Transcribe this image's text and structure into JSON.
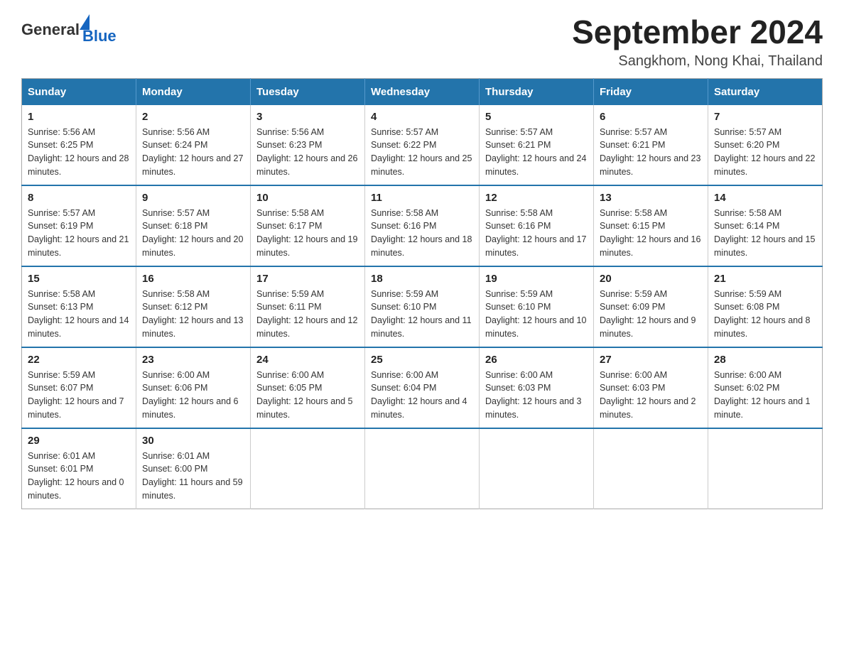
{
  "logo": {
    "text_general": "General",
    "text_blue": "Blue"
  },
  "header": {
    "title": "September 2024",
    "location": "Sangkhom, Nong Khai, Thailand"
  },
  "weekdays": [
    "Sunday",
    "Monday",
    "Tuesday",
    "Wednesday",
    "Thursday",
    "Friday",
    "Saturday"
  ],
  "weeks": [
    [
      {
        "day": "1",
        "sunrise": "5:56 AM",
        "sunset": "6:25 PM",
        "daylight": "12 hours and 28 minutes."
      },
      {
        "day": "2",
        "sunrise": "5:56 AM",
        "sunset": "6:24 PM",
        "daylight": "12 hours and 27 minutes."
      },
      {
        "day": "3",
        "sunrise": "5:56 AM",
        "sunset": "6:23 PM",
        "daylight": "12 hours and 26 minutes."
      },
      {
        "day": "4",
        "sunrise": "5:57 AM",
        "sunset": "6:22 PM",
        "daylight": "12 hours and 25 minutes."
      },
      {
        "day": "5",
        "sunrise": "5:57 AM",
        "sunset": "6:21 PM",
        "daylight": "12 hours and 24 minutes."
      },
      {
        "day": "6",
        "sunrise": "5:57 AM",
        "sunset": "6:21 PM",
        "daylight": "12 hours and 23 minutes."
      },
      {
        "day": "7",
        "sunrise": "5:57 AM",
        "sunset": "6:20 PM",
        "daylight": "12 hours and 22 minutes."
      }
    ],
    [
      {
        "day": "8",
        "sunrise": "5:57 AM",
        "sunset": "6:19 PM",
        "daylight": "12 hours and 21 minutes."
      },
      {
        "day": "9",
        "sunrise": "5:57 AM",
        "sunset": "6:18 PM",
        "daylight": "12 hours and 20 minutes."
      },
      {
        "day": "10",
        "sunrise": "5:58 AM",
        "sunset": "6:17 PM",
        "daylight": "12 hours and 19 minutes."
      },
      {
        "day": "11",
        "sunrise": "5:58 AM",
        "sunset": "6:16 PM",
        "daylight": "12 hours and 18 minutes."
      },
      {
        "day": "12",
        "sunrise": "5:58 AM",
        "sunset": "6:16 PM",
        "daylight": "12 hours and 17 minutes."
      },
      {
        "day": "13",
        "sunrise": "5:58 AM",
        "sunset": "6:15 PM",
        "daylight": "12 hours and 16 minutes."
      },
      {
        "day": "14",
        "sunrise": "5:58 AM",
        "sunset": "6:14 PM",
        "daylight": "12 hours and 15 minutes."
      }
    ],
    [
      {
        "day": "15",
        "sunrise": "5:58 AM",
        "sunset": "6:13 PM",
        "daylight": "12 hours and 14 minutes."
      },
      {
        "day": "16",
        "sunrise": "5:58 AM",
        "sunset": "6:12 PM",
        "daylight": "12 hours and 13 minutes."
      },
      {
        "day": "17",
        "sunrise": "5:59 AM",
        "sunset": "6:11 PM",
        "daylight": "12 hours and 12 minutes."
      },
      {
        "day": "18",
        "sunrise": "5:59 AM",
        "sunset": "6:10 PM",
        "daylight": "12 hours and 11 minutes."
      },
      {
        "day": "19",
        "sunrise": "5:59 AM",
        "sunset": "6:10 PM",
        "daylight": "12 hours and 10 minutes."
      },
      {
        "day": "20",
        "sunrise": "5:59 AM",
        "sunset": "6:09 PM",
        "daylight": "12 hours and 9 minutes."
      },
      {
        "day": "21",
        "sunrise": "5:59 AM",
        "sunset": "6:08 PM",
        "daylight": "12 hours and 8 minutes."
      }
    ],
    [
      {
        "day": "22",
        "sunrise": "5:59 AM",
        "sunset": "6:07 PM",
        "daylight": "12 hours and 7 minutes."
      },
      {
        "day": "23",
        "sunrise": "6:00 AM",
        "sunset": "6:06 PM",
        "daylight": "12 hours and 6 minutes."
      },
      {
        "day": "24",
        "sunrise": "6:00 AM",
        "sunset": "6:05 PM",
        "daylight": "12 hours and 5 minutes."
      },
      {
        "day": "25",
        "sunrise": "6:00 AM",
        "sunset": "6:04 PM",
        "daylight": "12 hours and 4 minutes."
      },
      {
        "day": "26",
        "sunrise": "6:00 AM",
        "sunset": "6:03 PM",
        "daylight": "12 hours and 3 minutes."
      },
      {
        "day": "27",
        "sunrise": "6:00 AM",
        "sunset": "6:03 PM",
        "daylight": "12 hours and 2 minutes."
      },
      {
        "day": "28",
        "sunrise": "6:00 AM",
        "sunset": "6:02 PM",
        "daylight": "12 hours and 1 minute."
      }
    ],
    [
      {
        "day": "29",
        "sunrise": "6:01 AM",
        "sunset": "6:01 PM",
        "daylight": "12 hours and 0 minutes."
      },
      {
        "day": "30",
        "sunrise": "6:01 AM",
        "sunset": "6:00 PM",
        "daylight": "11 hours and 59 minutes."
      },
      null,
      null,
      null,
      null,
      null
    ]
  ]
}
